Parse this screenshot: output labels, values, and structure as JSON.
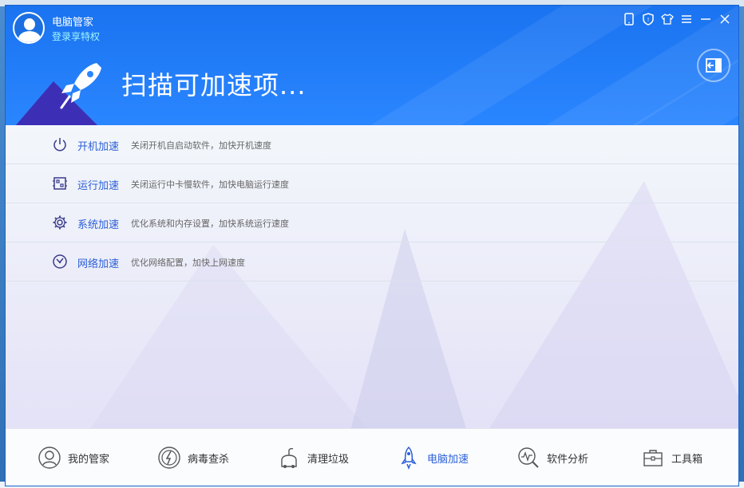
{
  "app": {
    "title": "电脑管家",
    "login_text": "登录享特权"
  },
  "header": {
    "scan_title": "扫描可加速项..."
  },
  "rows": [
    {
      "name": "开机加速",
      "desc": "关闭开机自启动软件，加快开机速度",
      "icon": "power-icon"
    },
    {
      "name": "运行加速",
      "desc": "关闭运行中卡慢软件，加快电脑运行速度",
      "icon": "memory-icon"
    },
    {
      "name": "系统加速",
      "desc": "优化系统和内存设置，加快系统运行速度",
      "icon": "gear-icon"
    },
    {
      "name": "网络加速",
      "desc": "优化网络配置，加快上网速度",
      "icon": "network-icon"
    }
  ],
  "nav": [
    {
      "label": "我的管家",
      "icon": "butler-icon",
      "active": false
    },
    {
      "label": "病毒查杀",
      "icon": "virus-scan-icon",
      "active": false
    },
    {
      "label": "清理垃圾",
      "icon": "cleanup-icon",
      "active": false
    },
    {
      "label": "电脑加速",
      "icon": "rocket-icon",
      "active": true
    },
    {
      "label": "软件分析",
      "icon": "analysis-icon",
      "active": false
    },
    {
      "label": "工具箱",
      "icon": "toolbox-icon",
      "active": false
    }
  ],
  "colors": {
    "header_blue": "#1a73f0",
    "accent_blue": "#2b5fd8",
    "login_cyan": "#9ff6ff"
  }
}
